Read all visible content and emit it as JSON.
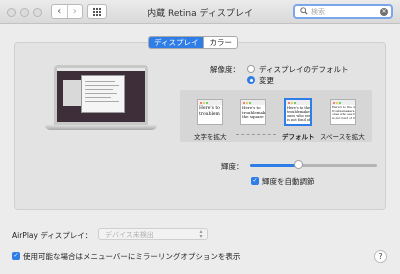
{
  "window": {
    "title": "内蔵 Retina ディスプレイ"
  },
  "search": {
    "placeholder": "検索"
  },
  "tabs": [
    {
      "label": "ディスプレイ",
      "active": true
    },
    {
      "label": "カラー",
      "active": false
    }
  ],
  "resolution": {
    "label": "解像度：",
    "options": [
      {
        "label": "ディスプレイのデフォルト",
        "selected": false
      },
      {
        "label": "変更",
        "selected": true
      }
    ]
  },
  "scaled_options": [
    {
      "label": "文字を拡大",
      "preview_text": [
        "Here's to",
        "troublem"
      ],
      "selected": false
    },
    {
      "label": "",
      "preview_text": [
        "Here's to",
        "troublemaker",
        "the square"
      ],
      "selected": false
    },
    {
      "label": "デフォルト",
      "preview_text": [
        "Here's to the",
        "troublemaker",
        "ones who see",
        "is not fond of"
      ],
      "selected": true
    },
    {
      "label": "スペースを拡大",
      "preview_text": [
        "Here's to the crazy",
        "troublemakers. The",
        "ones who see thing",
        "is not fond of rul"
      ],
      "selected": false
    }
  ],
  "brightness": {
    "label": "輝度：",
    "value": 0.38,
    "auto_label": "輝度を自動調節",
    "auto_checked": true
  },
  "airplay": {
    "label": "AirPlay ディスプレイ：",
    "value": "デバイス未検出"
  },
  "mirroring": {
    "label": "使用可能な場合はメニューバーにミラーリングオプションを表示",
    "checked": true
  },
  "colors": {
    "accent": "#2f7de6",
    "close": "#f25b53",
    "minimize": "#f6bd2d",
    "zoom": "#3cc840"
  }
}
